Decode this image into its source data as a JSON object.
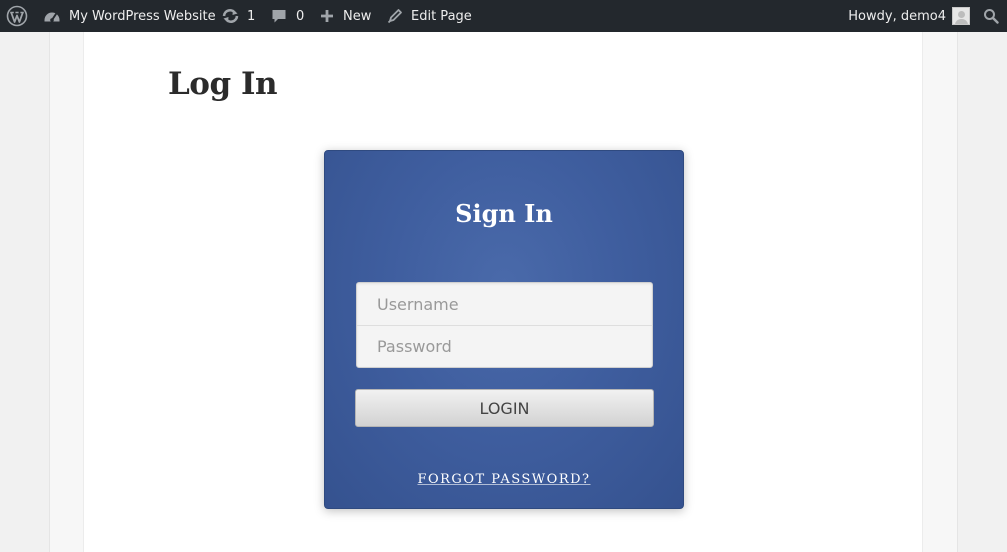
{
  "adminbar": {
    "site_name": "My WordPress Website",
    "updates_count": "1",
    "comments_count": "0",
    "new_label": "New",
    "edit_label": "Edit Page",
    "howdy": "Howdy, demo4"
  },
  "page": {
    "title": "Log In"
  },
  "login": {
    "heading": "Sign In",
    "username_placeholder": "Username",
    "password_placeholder": "Password",
    "button_label": "LOGIN",
    "forgot_label": "FORGOT PASSWORD?"
  },
  "colors": {
    "adminbar_bg": "#23282d",
    "card_bg": "#3f5e9f"
  },
  "icons": [
    "wordpress-logo-icon",
    "dashboard-icon",
    "updates-icon",
    "comments-icon",
    "plus-icon",
    "pencil-icon",
    "avatar",
    "search-icon"
  ]
}
